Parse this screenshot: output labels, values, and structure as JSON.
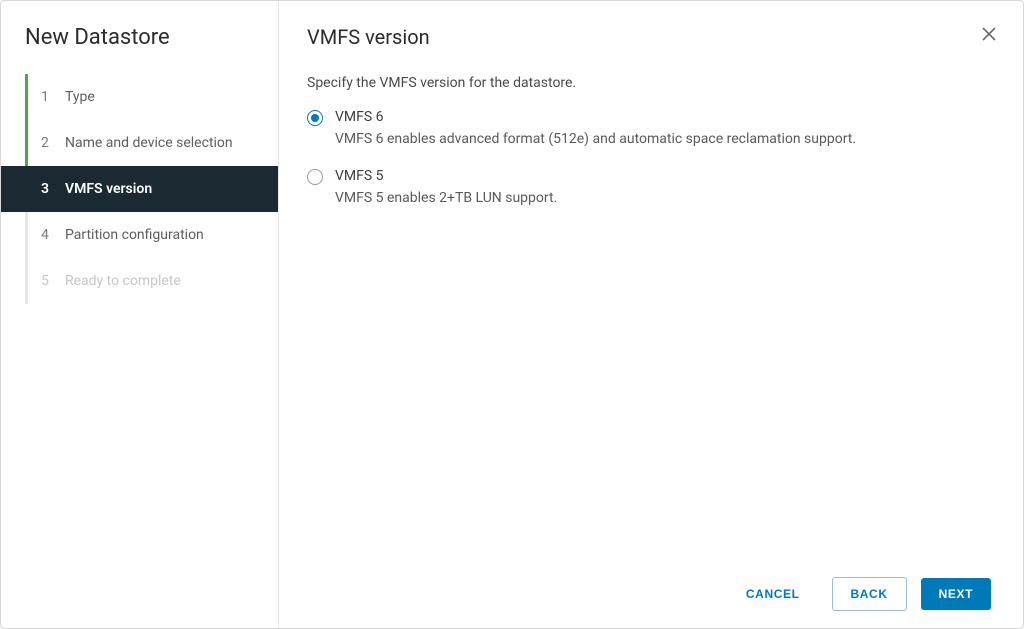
{
  "wizard_title": "New Datastore",
  "steps": [
    {
      "num": "1",
      "label": "Type",
      "state": "done"
    },
    {
      "num": "2",
      "label": "Name and device selection",
      "state": "done"
    },
    {
      "num": "3",
      "label": "VMFS version",
      "state": "active"
    },
    {
      "num": "4",
      "label": "Partition configuration",
      "state": "future"
    },
    {
      "num": "5",
      "label": "Ready to complete",
      "state": "disabled"
    }
  ],
  "page_title": "VMFS version",
  "instruction": "Specify the VMFS version for the datastore.",
  "options": [
    {
      "label": "VMFS 6",
      "description": "VMFS 6 enables advanced format (512e) and automatic space reclamation support.",
      "selected": true
    },
    {
      "label": "VMFS 5",
      "description": "VMFS 5 enables 2+TB LUN support.",
      "selected": false
    }
  ],
  "buttons": {
    "cancel": "CANCEL",
    "back": "BACK",
    "next": "NEXT"
  },
  "colors": {
    "accent": "#0079b8",
    "sidebar_active_bg": "#1b2a32",
    "progress_green": "#52a452"
  }
}
